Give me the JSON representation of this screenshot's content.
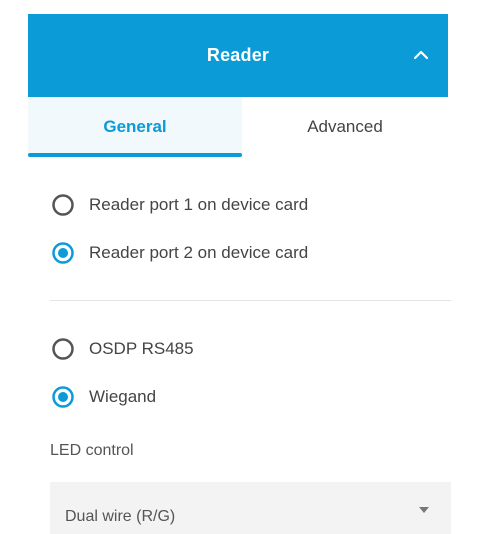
{
  "header": {
    "title": "Reader",
    "accent_color": "#0b9bd6",
    "toggle_icon": "chevron-up-icon"
  },
  "tabs": [
    {
      "label": "General",
      "selected": true
    },
    {
      "label": "Advanced",
      "selected": false
    }
  ],
  "port_options": [
    {
      "label": "Reader port 1 on device card",
      "checked": false
    },
    {
      "label": "Reader port 2 on device card",
      "checked": true
    }
  ],
  "protocol_options": [
    {
      "label": "OSDP RS485",
      "checked": false
    },
    {
      "label": "Wiegand",
      "checked": true
    }
  ],
  "led_control": {
    "label": "LED control",
    "value": "Dual wire (R/G)",
    "arrow_icon": "caret-down-icon"
  }
}
